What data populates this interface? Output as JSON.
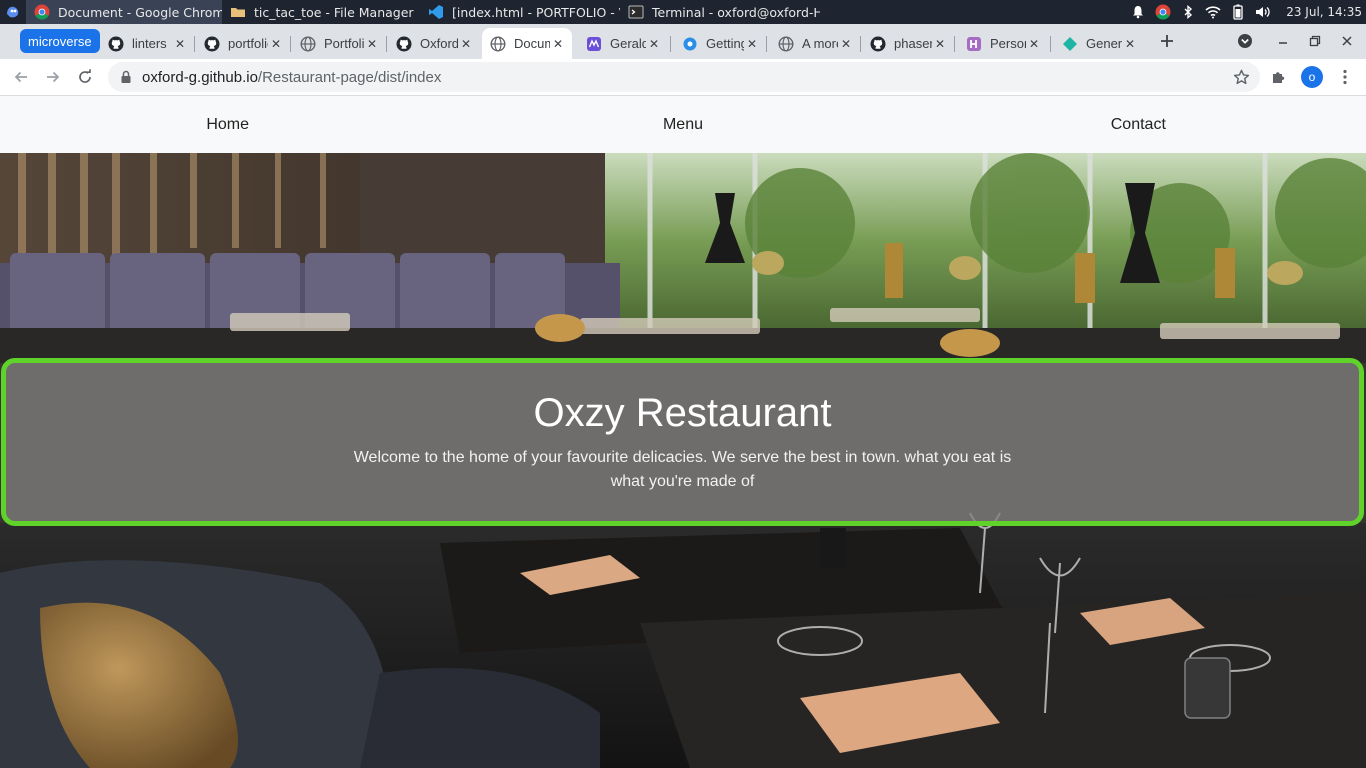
{
  "taskbar": {
    "tasks": [
      {
        "label": "Document - Google Chrome",
        "icon": "chrome-icon"
      },
      {
        "label": "tic_tac_toe - File Manager",
        "icon": "folder-icon"
      },
      {
        "label": "[index.html - PORTFOLIO - Vi...",
        "icon": "vscode-icon"
      },
      {
        "label": "Terminal - oxford@oxford-H...",
        "icon": "terminal-icon"
      }
    ],
    "clock": "23 Jul, 14:35"
  },
  "browser": {
    "tab_group_label": "microverse",
    "tabs": [
      {
        "title": "linters",
        "icon": "github-icon"
      },
      {
        "title": "portfolio",
        "icon": "github-icon"
      },
      {
        "title": "Portfolio",
        "icon": "globe-icon"
      },
      {
        "title": "Oxford",
        "icon": "github-icon"
      },
      {
        "title": "Document",
        "icon": "globe-icon"
      },
      {
        "title": "Gerald",
        "icon": "app-icon"
      },
      {
        "title": "Getting",
        "icon": "app-icon"
      },
      {
        "title": "A more",
        "icon": "globe-icon"
      },
      {
        "title": "phaser",
        "icon": "github-icon"
      },
      {
        "title": "Personal",
        "icon": "app-icon"
      },
      {
        "title": "Generate",
        "icon": "app-icon"
      }
    ],
    "url_host": "oxford-g.github.io",
    "url_path": "/Restaurant-page/dist/index",
    "profile_initial": "o"
  },
  "site": {
    "nav": {
      "home": "Home",
      "menu": "Menu",
      "contact": "Contact"
    },
    "title": "Oxzy Restaurant",
    "tagline": "Welcome to the home of your favourite delicacies. We serve the best in town. what you eat is what you're made of"
  },
  "colors": {
    "accent": "#5fd32a",
    "chrome_blue": "#1a73e8"
  }
}
